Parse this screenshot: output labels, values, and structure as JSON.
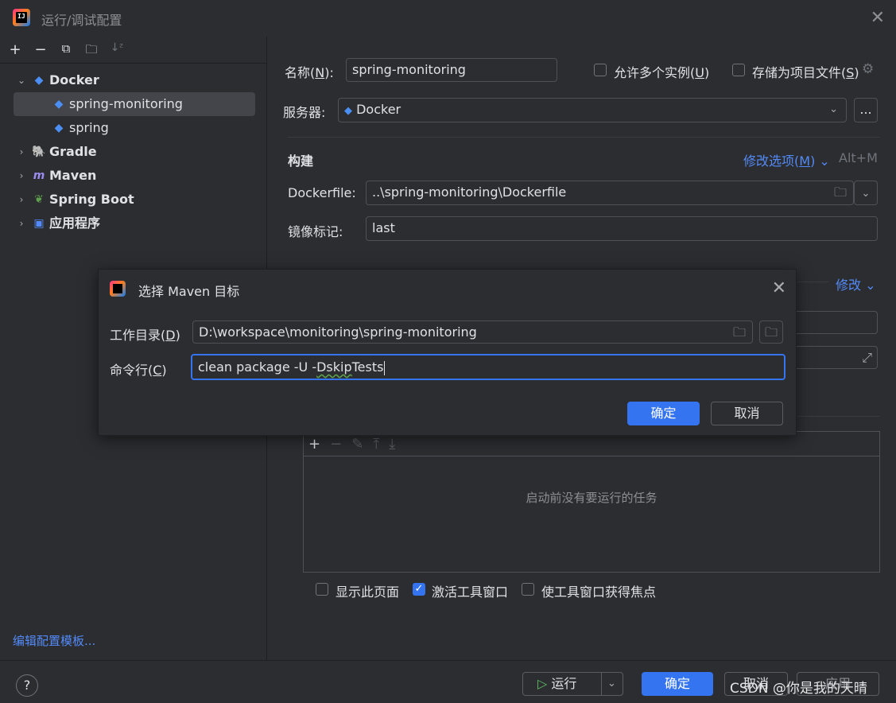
{
  "window": {
    "title": "运行/调试配置",
    "close_glyph": "✕",
    "logo_text": "IJ"
  },
  "left": {
    "toolbar": {
      "add": "+",
      "remove": "−",
      "copy": "⧉",
      "new_folder": "🗀",
      "sort": "↓ᶻ"
    },
    "tree": [
      {
        "label": "Docker",
        "icon": "docker-icon",
        "expanded": true
      },
      {
        "label": "spring-monitoring",
        "icon": "docker-icon",
        "selected": true
      },
      {
        "label": "spring",
        "icon": "docker-icon"
      },
      {
        "label": "Gradle",
        "icon": "gradle-icon"
      },
      {
        "label": "Maven",
        "icon": "maven-icon"
      },
      {
        "label": "Spring Boot",
        "icon": "spring-boot-icon"
      },
      {
        "label": "应用程序",
        "icon": "application-icon"
      }
    ],
    "edit_template": "编辑配置模板..."
  },
  "form": {
    "name_label_pre": "名称(",
    "name_label_key": "N",
    "name_label_post": "):",
    "name_value": "spring-monitoring",
    "allow_multiple_pre": "允许多个实例(",
    "allow_multiple_key": "U",
    "allow_multiple_post": ")",
    "store_as_file_pre": "存储为项目文件(",
    "store_as_file_key": "S",
    "store_as_file_post": ")",
    "server_label": "服务器:",
    "server_value": "Docker",
    "more_button": "...",
    "build_section": "构建",
    "modify_options_pre": "修改选项(",
    "modify_options_key": "M",
    "modify_options_post": ")",
    "modify_shortcut": "Alt+M",
    "dockerfile_label": "Dockerfile:",
    "dockerfile_value": "..\\spring-monitoring\\Dockerfile",
    "image_tag_label": "镜像标记:",
    "image_tag_value": "last",
    "modify_link": "修改",
    "task_empty": "启动前没有要运行的任务",
    "show_page": "显示此页面",
    "activate_tool": "激活工具窗口",
    "focus_tool": "使工具窗口获得焦点"
  },
  "bottom": {
    "help": "?",
    "run": "运行",
    "ok": "确定",
    "cancel": "取消",
    "apply": "应用",
    "watermark": "CSDN @你是我的天晴"
  },
  "modal": {
    "title": "选择 Maven 目标",
    "workdir_label_pre": "工作目录(",
    "workdir_label_key": "D",
    "workdir_label_post": ")",
    "workdir_value": "D:\\workspace\\monitoring\\spring-monitoring",
    "cmd_label_pre": "命令行(",
    "cmd_label_key": "C",
    "cmd_label_post": ")",
    "cmd_value_pre": "clean package -U -",
    "cmd_value_squig": "Dskip",
    "cmd_value_post": "Tests",
    "ok": "确定",
    "cancel": "取消"
  },
  "colors": {
    "accent": "#3574f0",
    "link": "#548af7",
    "background": "#2b2d30",
    "selection": "#43454a"
  }
}
